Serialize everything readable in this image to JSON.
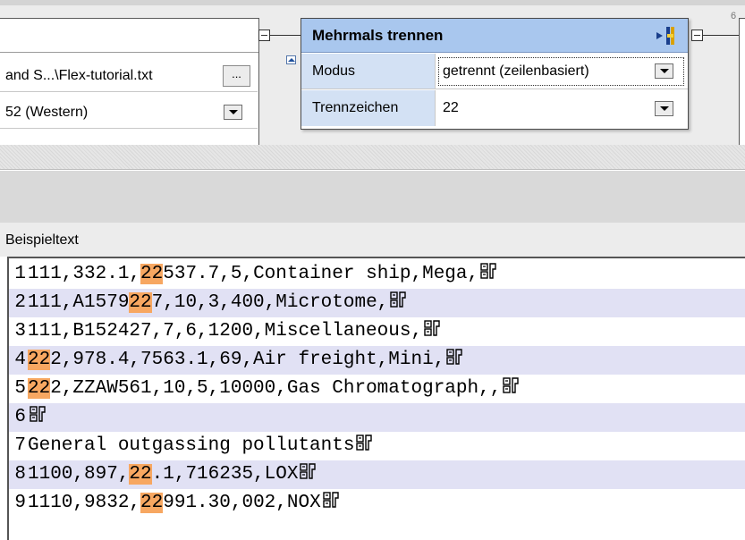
{
  "file_component": {
    "file_path": "and S...\\Flex-tutorial.txt",
    "browse_label": "...",
    "encoding": "52 (Western)"
  },
  "separator_component": {
    "title": "Mehrmals trennen",
    "mode_label": "Modus",
    "mode_value": "getrennt (zeilenbasiert)",
    "delimiter_label": "Trennzeichen",
    "delimiter_value": "22"
  },
  "page_number": "6",
  "sample_panel": {
    "label": "Beispieltext",
    "highlight_color": "#f7a761",
    "alt_row_color": "#e1e1f4",
    "lines": [
      {
        "num": "1",
        "segments": [
          {
            "text": "111,332.1,",
            "hl": false
          },
          {
            "text": "22",
            "hl": true
          },
          {
            "text": "537.7,5,Container ship,Mega,",
            "hl": false
          }
        ]
      },
      {
        "num": "2",
        "segments": [
          {
            "text": "111,A1579",
            "hl": false
          },
          {
            "text": "22",
            "hl": true
          },
          {
            "text": "7,10,3,400,Microtome,",
            "hl": false
          }
        ]
      },
      {
        "num": "3",
        "segments": [
          {
            "text": "111,B152427,7,6,1200,Miscellaneous,",
            "hl": false
          }
        ]
      },
      {
        "num": "4",
        "segments": [
          {
            "text": "22",
            "hl": true
          },
          {
            "text": "2,978.4,7563.1,69,Air freight,Mini,",
            "hl": false
          }
        ]
      },
      {
        "num": "5",
        "segments": [
          {
            "text": "22",
            "hl": true
          },
          {
            "text": "2,ZZAW561,10,5,10000,Gas Chromatograph,,",
            "hl": false
          }
        ]
      },
      {
        "num": "6",
        "segments": []
      },
      {
        "num": "7",
        "segments": [
          {
            "text": "General outgassing pollutants",
            "hl": false
          }
        ]
      },
      {
        "num": "8",
        "segments": [
          {
            "text": "1100,897,",
            "hl": false
          },
          {
            "text": "22",
            "hl": true
          },
          {
            "text": ".1,716235,LOX",
            "hl": false
          }
        ]
      },
      {
        "num": "9",
        "segments": [
          {
            "text": "1110,9832,",
            "hl": false
          },
          {
            "text": "22",
            "hl": true
          },
          {
            "text": "991.30,002,NOX",
            "hl": false
          }
        ]
      }
    ]
  }
}
